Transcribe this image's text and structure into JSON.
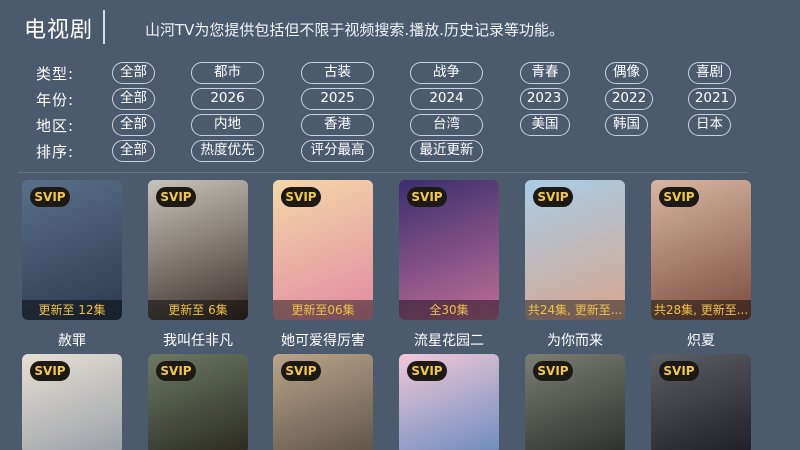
{
  "header": {
    "title": "电视剧",
    "subtitle": "山河TV为您提供包括但不限于视频搜索.播放.历史记录等功能。"
  },
  "filters": [
    {
      "label": "类型:",
      "options": [
        "全部",
        "都市",
        "古装",
        "战争",
        "青春",
        "偶像",
        "喜剧"
      ]
    },
    {
      "label": "年份:",
      "options": [
        "全部",
        "2026",
        "2025",
        "2024",
        "2023",
        "2022",
        "2021"
      ]
    },
    {
      "label": "地区:",
      "options": [
        "全部",
        "内地",
        "香港",
        "台湾",
        "美国",
        "韩国",
        "日本"
      ]
    },
    {
      "label": "排序:",
      "options": [
        "全部",
        "热度优先",
        "评分最高",
        "最近更新"
      ]
    }
  ],
  "posters_row1": [
    {
      "badge": "SVIP",
      "episode": "更新至 12集",
      "title": "赦罪",
      "colors": [
        "#5a6f8a",
        "#2c3a4e"
      ]
    },
    {
      "badge": "SVIP",
      "episode": "更新至 6集",
      "title": "我叫任非凡",
      "colors": [
        "#c9c4bb",
        "#3a2e2a"
      ]
    },
    {
      "badge": "SVIP",
      "episode": "更新至06集",
      "title": "她可爱得厉害",
      "colors": [
        "#f4d8a8",
        "#e08aa0"
      ]
    },
    {
      "badge": "SVIP",
      "episode": "全30集",
      "title": "流星花园二",
      "colors": [
        "#3b2e6e",
        "#c06f98"
      ]
    },
    {
      "badge": "SVIP",
      "episode": "共24集, 更新至...",
      "title": "为你而来",
      "colors": [
        "#a9cde6",
        "#d7a58e"
      ]
    },
    {
      "badge": "SVIP",
      "episode": "共28集, 更新至...",
      "title": "炽夏",
      "colors": [
        "#d8b6a2",
        "#7a4c3e"
      ]
    }
  ],
  "posters_row2": [
    {
      "badge": "SVIP",
      "colors": [
        "#e6dfd4",
        "#9aa0a8"
      ]
    },
    {
      "badge": "SVIP",
      "colors": [
        "#6b7a64",
        "#2c2a22"
      ]
    },
    {
      "badge": "SVIP",
      "colors": [
        "#b9a58a",
        "#5e5448"
      ]
    },
    {
      "badge": "SVIP",
      "colors": [
        "#f1c8d8",
        "#6c8cbf"
      ]
    },
    {
      "badge": "SVIP",
      "colors": [
        "#7a7e74",
        "#2e302c"
      ]
    },
    {
      "badge": "SVIP",
      "colors": [
        "#5d5f66",
        "#1e1f24"
      ]
    }
  ]
}
